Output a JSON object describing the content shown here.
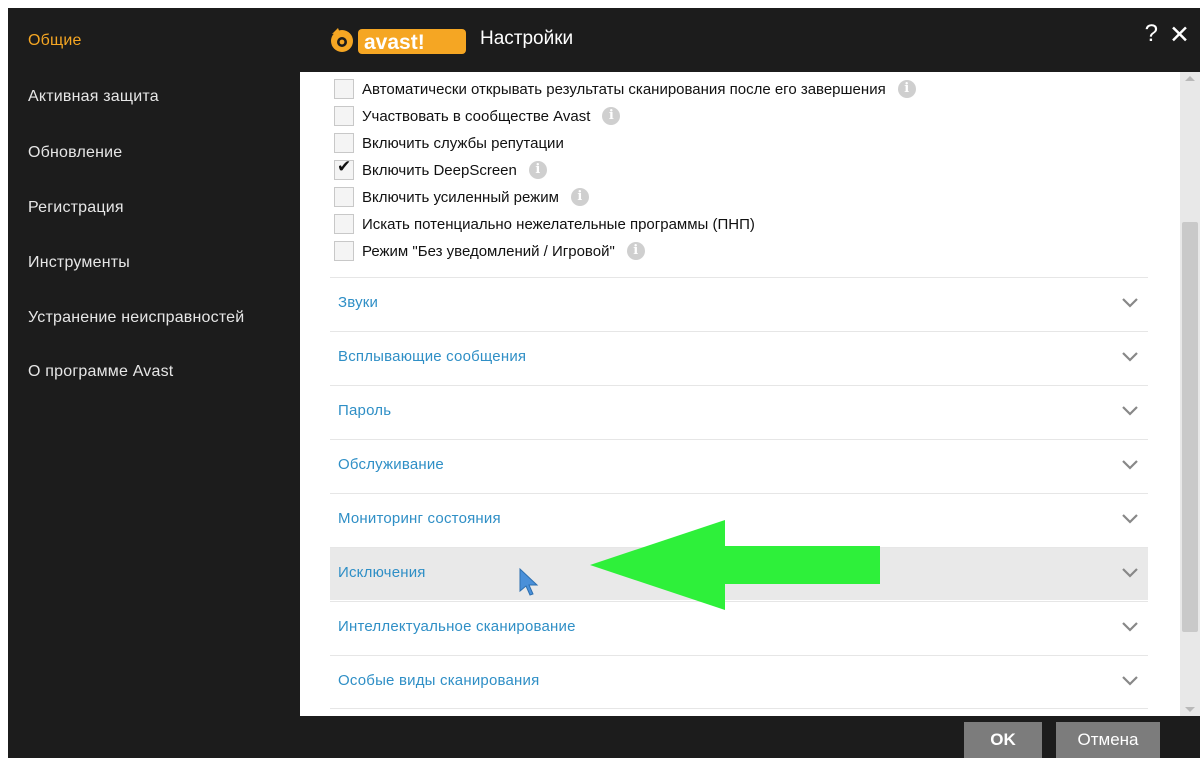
{
  "colors": {
    "accent_orange": "#f5a623",
    "link_blue": "#2f8fc6",
    "dark_bg": "#1c1c1c",
    "arrow_green": "#2ef03a"
  },
  "window": {
    "brand": "avast!",
    "title": "Настройки",
    "help": "?",
    "close": "✕"
  },
  "sidebar": {
    "items": [
      {
        "label": "Общие",
        "active": true
      },
      {
        "label": "Активная защита"
      },
      {
        "label": "Обновление"
      },
      {
        "label": "Регистрация"
      },
      {
        "label": "Инструменты"
      },
      {
        "label": "Устранение неисправностей"
      },
      {
        "label": "О программе Avast"
      }
    ]
  },
  "options": [
    {
      "label": "Автоматически открывать результаты сканирования после его завершения",
      "checked": false,
      "info": true
    },
    {
      "label": "Участвовать в сообществе Avast",
      "checked": false,
      "info": true
    },
    {
      "label": "Включить службы репутации",
      "checked": false,
      "info": false
    },
    {
      "label": "Включить DeepScreen",
      "checked": true,
      "info": true
    },
    {
      "label": "Включить усиленный режим",
      "checked": false,
      "info": true
    },
    {
      "label": "Искать потенциально нежелательные программы (ПНП)",
      "checked": false,
      "info": false
    },
    {
      "label": "Режим \"Без уведомлений / Игровой\"",
      "checked": false,
      "info": true
    }
  ],
  "sections": [
    {
      "label": "Звуки"
    },
    {
      "label": "Всплывающие сообщения"
    },
    {
      "label": "Пароль"
    },
    {
      "label": "Обслуживание"
    },
    {
      "label": "Мониторинг состояния"
    },
    {
      "label": "Исключения",
      "highlighted": true
    },
    {
      "label": "Интеллектуальное сканирование"
    },
    {
      "label": "Особые виды сканирования"
    }
  ],
  "footer": {
    "ok": "OK",
    "cancel": "Отмена"
  },
  "icons": {
    "info": "info-icon",
    "chevron": "chevron-down-icon",
    "check": "checkmark-icon"
  }
}
